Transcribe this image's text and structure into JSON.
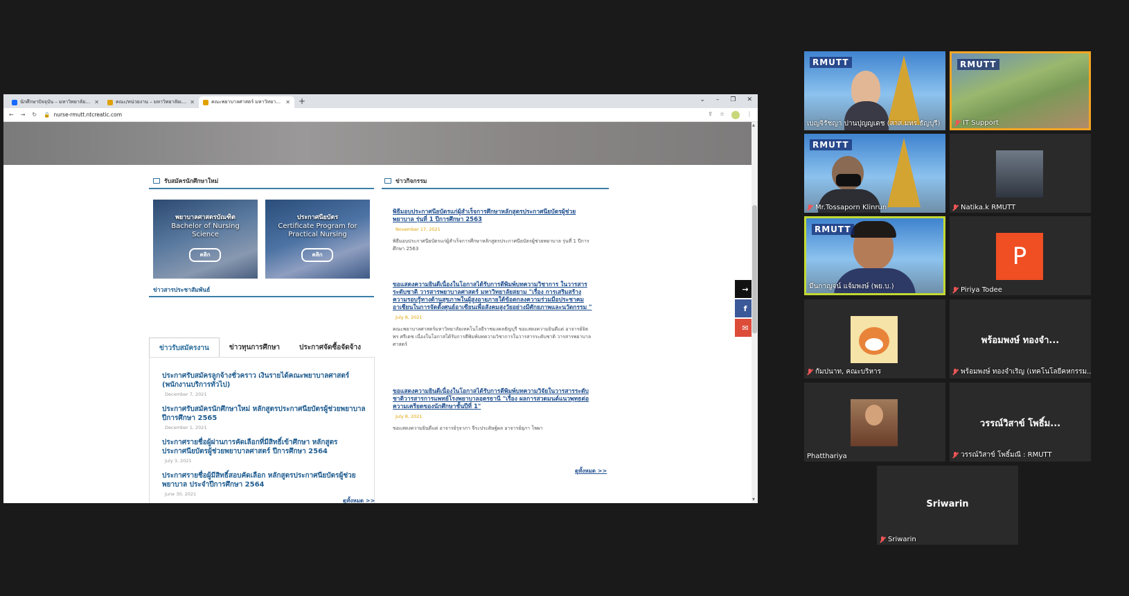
{
  "browser": {
    "tabs": [
      {
        "title": "นักศึกษาปัจจุบัน – มหาวิทยาลัยเทคโนโ...",
        "icon": "behance-icon",
        "active": false
      },
      {
        "title": "คณะ/หน่วยงาน – มหาวิทยาลัยเทคโนโ...",
        "icon": "page-icon",
        "active": false
      },
      {
        "title": "คณะพยาบาลศาสตร์ มหาวิทยาลัยเทคโ...",
        "icon": "page-icon",
        "active": true
      }
    ],
    "new_tab": "+",
    "url": "nurse-rmutt.ntcreatic.com"
  },
  "page": {
    "admissions_title": "รับสมัครนักศึกษาใหม่",
    "activities_title": "ข่าวกิจกรรม",
    "pr_title": "ข่าวสารประชาสัมพันธ์",
    "promos": [
      {
        "thai": "พยาบาลศาสตรบัณฑิต",
        "english": "Bachelor of Nursing Science",
        "button": "คลิก"
      },
      {
        "thai": "ประกาศนียบัตร",
        "english": "Certificate Program for Practical Nursing",
        "button": "คลิก"
      }
    ],
    "pr_tabs": [
      "ข่าวรับสมัครงาน",
      "ข่าวทุนการศึกษา",
      "ประกาศจัดซื้อจัดจ้าง"
    ],
    "pr_items": [
      {
        "title": "ประกาศรับสมัครลูกจ้างชั่วคราว เงินรายได้คณะพยาบาลศาสตร์ (พนักงานบริการทั่วไป)",
        "date": "December 7, 2021"
      },
      {
        "title": "ประกาศรับสมัครนักศึกษาใหม่ หลักสูตรประกาศนียบัตรผู้ช่วยพยาบาล ปีการศึกษา 2565",
        "date": "December 1, 2021"
      },
      {
        "title": "ประกาศรายชื่อผู้ผ่านการคัดเลือกที่มีสิทธิ์เข้าศึกษา หลักสูตรประกาศนียบัตรผู้ช่วยพยาบาลศาสตร์ ปีการศึกษา 2564",
        "date": "July 3, 2021"
      },
      {
        "title": "ประกาศรายชื่อผู้มีสิทธิ์สอบคัดเลือก หลักสูตรประกาศนียบัตรผู้ช่วยพยาบาล ประจำปีการศึกษา 2564",
        "date": "June 30, 2021"
      }
    ],
    "pr_see_all": "ดูทั้งหมด >>",
    "news_items": [
      {
        "title": "พิธีมอบประกาศนียบัตรแก่ผู้สำเร็จการศึกษาหลักสูตรประกาศนียบัตรผู้ช่วยพยาบาล รุ่นที่ 1 ปีการศึกษา 2563",
        "date": "November 17, 2021",
        "excerpt": "พิธีมอบประกาศนียบัตรแก่ผู้สำเร็จการศึกษาหลักสูตรประกาศนียบัตรผู้ช่วยพยาบาล รุ่นที่ 1 ปีการศึกษา 2563"
      },
      {
        "title": "ขอแสดงความยินดีเนื่องในโอกาสได้รับการตีพิมพ์บทความวิชาการ ในวารสารระดับชาติ วารสารพยาบาลศาสตร์ มหาวิทยาลัยสยาม \"เรื่อง การเสริมสร้างความรอบรู้ทางด้านสุขภาพในผู้สูงอายุภายใต้ข้อตกลงความร่วมมือประชาคมอาเซียนในการจัดตั้งศูนย์อาเซียนเพื่อสังคมสูงวัยอย่างมีศักยภาพและนวัตกรรม \"",
        "date": "July 8, 2021",
        "excerpt": "คณะพยาบาลศาสตร์มหาวิทยาลัยเทคโนโลยีราชมงคลธัญบุรี ขอแสดงความยินดีแด่ อาจารย์จิตพร ศรีเดช เนื่องในโอกาสได้รับการตีพิมพ์บทความวิชาการในวารสารระดับชาติ วารสารพยาบาลศาสตร์"
      },
      {
        "title": "ขอแสดงความยินดีเนื่องในโอกาสได้รับการตีพิมพ์บทความวิจัยในวารสารระดับชาติวารสารการแพทย์โรงพยาบาลอุดรธานี \"เรื่อง ผลการสวดมนต์แนวพุทธต่อความเครียดของนักศึกษาชั้นปีที่ 1\"",
        "date": "July 8, 2021",
        "excerpt": "ขอแสดงความยินดีแด่ อาจารย์รุจาภา จีระประดิษฐ์ผล อาจารย์ยุภา โพผา"
      }
    ],
    "news_see_all": "ดูทั้งหมด >>",
    "social": {
      "share": "→",
      "facebook": "f",
      "email": "✉"
    }
  },
  "participants": [
    {
      "name": "เบญจิรัชญา ปานปุญญเดช (สาส.มทร.ธัญบุรี)",
      "muted": false,
      "type": "video"
    },
    {
      "name": "IT Support",
      "muted": true,
      "type": "video"
    },
    {
      "name": "Mr.Tossaporn Klinrun",
      "muted": true,
      "type": "video"
    },
    {
      "name": "Natika.k RMUTT",
      "muted": true,
      "type": "photo"
    },
    {
      "name": "มีนกาญจน์ แจ้มพงษ์ (พย.บ.)",
      "muted": false,
      "type": "video",
      "speaking": true
    },
    {
      "name": "Piriya Todee",
      "muted": true,
      "type": "avatar",
      "initial": "P",
      "color": "#f04e23"
    },
    {
      "name": "กัมปนาท, คณะบริหาร",
      "muted": true,
      "type": "photo"
    },
    {
      "name": "พร้อมพงษ์ ทองจำเริญ (เทคโนโลยีคหกรรม...",
      "muted": true,
      "type": "text",
      "display": "พร้อมพงษ์ ทองจำ..."
    },
    {
      "name": "Phatthariya",
      "muted": false,
      "type": "photo"
    },
    {
      "name": "วรรณ์วิสาข์ โพธิ์มณี : RMUTT",
      "muted": true,
      "type": "text",
      "display": "วรรณ์วิสาข์ โพธิ์ม..."
    },
    {
      "name": "Sriwarin",
      "muted": true,
      "type": "text",
      "display": "Sriwarin"
    }
  ],
  "rmutt_logo": "RMUTT"
}
